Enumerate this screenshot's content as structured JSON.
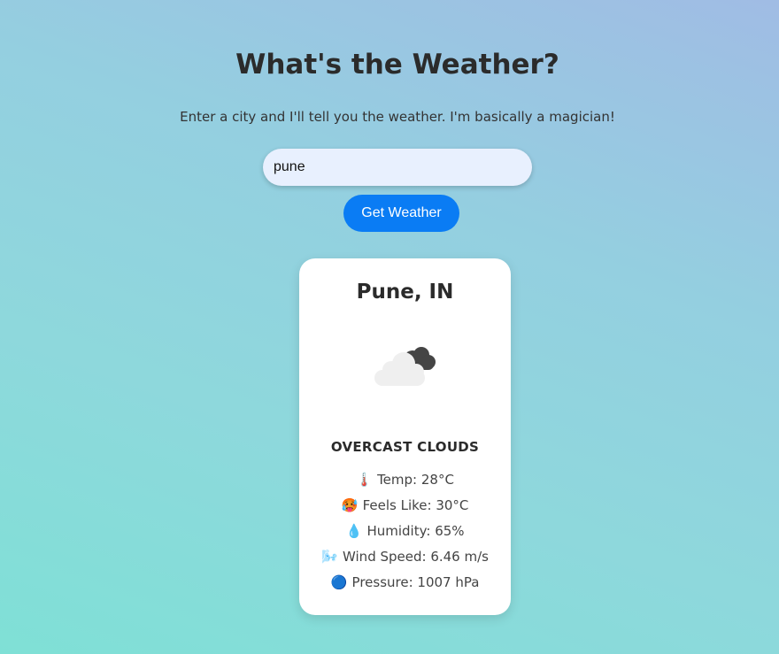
{
  "header": {
    "title": "What's the Weather?",
    "subtitle": "Enter a city and I'll tell you the weather. I'm basically a magician!"
  },
  "search": {
    "value": "pune",
    "button_label": "Get Weather"
  },
  "card": {
    "city": "Pune, IN",
    "icon": "overcast-clouds-icon",
    "condition": "OVERCAST CLOUDS",
    "stats": {
      "temp": {
        "icon": "🌡️",
        "text": "Temp: 28°C"
      },
      "feels_like": {
        "icon": "🥵",
        "text": "Feels Like: 30°C"
      },
      "humidity": {
        "icon": "💧",
        "text": "Humidity: 65%"
      },
      "wind": {
        "icon": "🌬️",
        "text": "Wind Speed: 6.46 m/s"
      },
      "pressure": {
        "icon": "🔵",
        "text": "Pressure: 1007 hPa"
      }
    }
  },
  "colors": {
    "button": "#0a7cf4",
    "input_bg": "#e8f0fe",
    "card_bg": "#ffffff",
    "text_dark": "#2b2b2b"
  }
}
